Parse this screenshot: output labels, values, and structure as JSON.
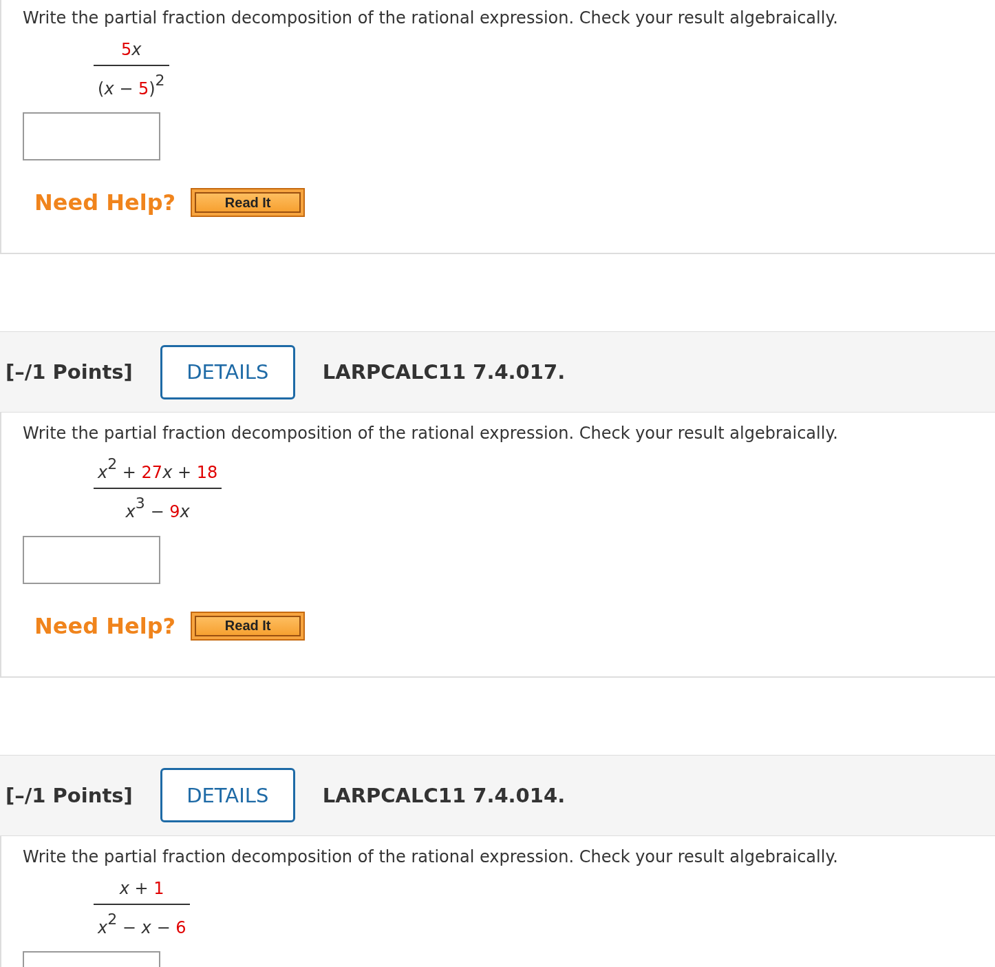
{
  "problems": [
    {
      "prompt": "Write the partial fraction decomposition of the rational expression. Check your result algebraically.",
      "numerator": [
        {
          "kind": "coef",
          "text": "5"
        },
        {
          "kind": "var",
          "text": "x"
        }
      ],
      "denominator": [
        {
          "kind": "op",
          "text": "("
        },
        {
          "kind": "var",
          "text": "x"
        },
        {
          "kind": "op",
          "text": " − "
        },
        {
          "kind": "coef",
          "text": "5"
        },
        {
          "kind": "op",
          "text": ")"
        },
        {
          "kind": "sup",
          "text": "2"
        }
      ],
      "help": {
        "label": "Need Help?",
        "button": "Read It"
      }
    },
    {
      "header": {
        "points": "[–/1 Points]",
        "details": "DETAILS",
        "code": "LARPCALC11 7.4.017."
      },
      "prompt": "Write the partial fraction decomposition of the rational expression. Check your result algebraically.",
      "numerator": [
        {
          "kind": "var",
          "text": "x"
        },
        {
          "kind": "sup",
          "text": "2"
        },
        {
          "kind": "op",
          "text": " + "
        },
        {
          "kind": "coef",
          "text": "27"
        },
        {
          "kind": "var",
          "text": "x"
        },
        {
          "kind": "op",
          "text": " + "
        },
        {
          "kind": "coef",
          "text": "18"
        }
      ],
      "denominator": [
        {
          "kind": "var",
          "text": "x"
        },
        {
          "kind": "sup",
          "text": "3"
        },
        {
          "kind": "op",
          "text": " − "
        },
        {
          "kind": "coef",
          "text": "9"
        },
        {
          "kind": "var",
          "text": "x"
        }
      ],
      "help": {
        "label": "Need Help?",
        "button": "Read It"
      }
    },
    {
      "header": {
        "points": "[–/1 Points]",
        "details": "DETAILS",
        "code": "LARPCALC11 7.4.014."
      },
      "prompt": "Write the partial fraction decomposition of the rational expression. Check your result algebraically.",
      "numerator": [
        {
          "kind": "var",
          "text": "x"
        },
        {
          "kind": "op",
          "text": " + "
        },
        {
          "kind": "coef",
          "text": "1"
        }
      ],
      "denominator": [
        {
          "kind": "var",
          "text": "x"
        },
        {
          "kind": "sup",
          "text": "2"
        },
        {
          "kind": "op",
          "text": " − "
        },
        {
          "kind": "var",
          "text": "x"
        },
        {
          "kind": "op",
          "text": " − "
        },
        {
          "kind": "coef",
          "text": "6"
        }
      ]
    }
  ]
}
